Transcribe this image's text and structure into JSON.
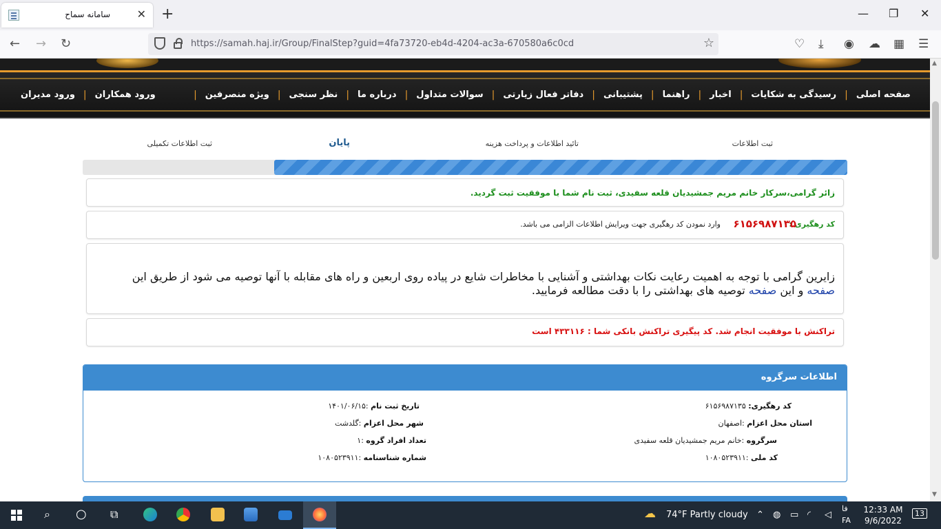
{
  "browser": {
    "tab_title": "سامانه سماح",
    "url": "https://samah.haj.ir/Group/FinalStep?guid=4fa73720-eb4d-4204-ac3a-670580a6c0cd"
  },
  "menu": {
    "items": [
      "صفحه اصلی",
      "رسیدگی به شکایات",
      "اخبار",
      "راهنما",
      "پشتیبانی",
      "دفاتر فعال زیارتی",
      "سوالات متداول",
      "درباره ما",
      "نظر سنجی",
      "ویژه منصرفین"
    ],
    "left_items": [
      "ورود همکاران",
      "ورود مدیران"
    ]
  },
  "steps": {
    "items": [
      "ثبت اطلاعات",
      "تائید اطلاعات و پرداخت هزینه",
      "پایان",
      "ثبت اطلاعات تکمیلی"
    ],
    "active_index": 2,
    "progress_fraction": 0.75
  },
  "messages": {
    "success": "زائر گرامی،سرکار خانم مریم جمشیدیان قلعه سفیدی، ثبت نام شما با موفقیت ثبت گردید.",
    "tracking_label": "کد رهگیری :",
    "tracking_code": "۶۱۵۶۹۸۷۱۳۵",
    "tracking_note": "وارد نمودن کد رهگیری جهت ویرایش اطلاعات الزامی می باشد.",
    "health_before": "زایرین گرامی با توجه به اهمیت رعایت نکات بهداشتی و آشنایی با مخاطرات شایع در پیاده روی اربعین و راه های مقابله با آنها توصیه می شود از طریق این ",
    "health_link1": "صفحه",
    "health_mid": " و این ",
    "health_link2": "صفحه",
    "health_after": " توصیه های بهداشتی را با دقت مطالعه فرمایید.",
    "transaction": "تراکنش با موفقیت انجام شد. کد پیگیری تراکنش بانکی شما : ۴۳۳۱۱۶ است"
  },
  "group_info": {
    "title": "اطلاعات سرگروه",
    "tracking_label": "کد رهگیری:",
    "tracking_value": " ۶۱۵۶۹۸۷۱۳۵",
    "province_label": "استان محل اعزام",
    "province_value": " :اصفهان",
    "leader_label": "سرگروه",
    "leader_value": " :خانم مریم جمشیدیان قلعه سفیدی",
    "national_label": "کد ملی",
    "national_value": " :۱۰۸۰۵۲۳۹۱۱",
    "reg_date_label": "تاریخ ثبت نام",
    "reg_date_value": " :۱۴۰۱/۰۶/۱۵",
    "city_label": "شهر محل اعزام",
    "city_value": " :گلدشت",
    "members_label": "تعداد افراد گروه",
    "members_value": " :۱",
    "id_label": "شماره شناسنامه",
    "id_value": " :۱۰۸۰۵۲۳۹۱۱"
  },
  "taskbar": {
    "weather": "74°F  Partly cloudy",
    "lang": "فا",
    "lang2": "FA",
    "time": "12:33 AM",
    "date": "9/6/2022",
    "notif_count": "13"
  }
}
